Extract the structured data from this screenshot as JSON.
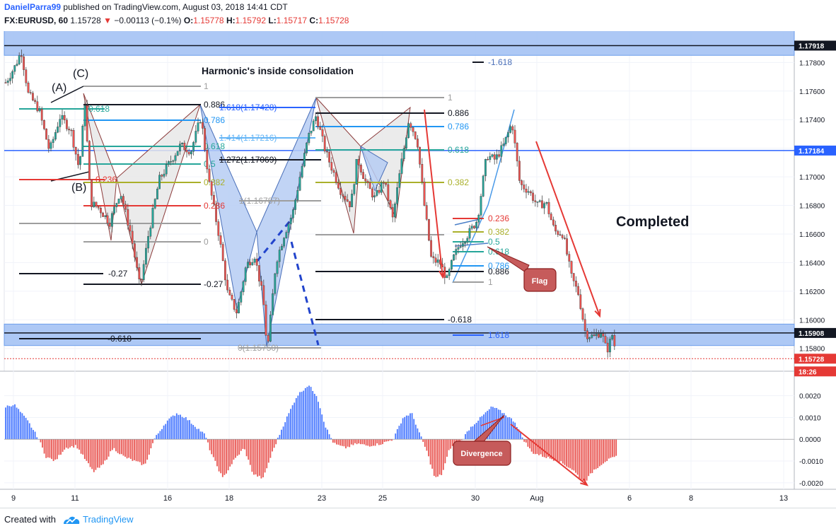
{
  "header": {
    "author": "DanielParra99",
    "published_text": "published on TradingView.com, August 03, 2018 14:41 CDT",
    "symbol": "FX:EURUSD, 60",
    "last": "1.15728",
    "change_arrow": "▼",
    "change": "−0.00113 (−0.1%)",
    "open_label": "O:",
    "open": "1.15778",
    "high_label": "H:",
    "high": "1.15792",
    "low_label": "L:",
    "low": "1.15717",
    "close_label": "C:",
    "close": "1.15728"
  },
  "footer": {
    "created_with": "Created with",
    "brand": "TradingView"
  },
  "colors": {
    "up_candle": "#26a69a",
    "down_candle": "#ef5350",
    "zone": "#a4c2f4",
    "pattern_fill": "#b6cdf3",
    "hist_up": "#2962ff",
    "hist_down": "#e53935",
    "arrow": "#e53935",
    "gold": "#aab02b",
    "accent_blue": "#2962ff"
  },
  "annotations": {
    "title": "Harmonic's inside consolidation",
    "completed": "Completed",
    "flag": "Flag",
    "divergence": "Divergence",
    "label_a": "(A)",
    "label_b": "(B)",
    "label_c": "(C)"
  },
  "chart_data": {
    "type": "candlestick",
    "symbol": "EURUSD",
    "timeframe": "60",
    "ylim": [
      1.1568,
      1.1797
    ],
    "x_ticks": [
      "9",
      "11",
      "16",
      "18",
      "23",
      "25",
      "30",
      "Aug",
      "6",
      "8",
      "13"
    ],
    "price_ticks": [
      "1.17800",
      "1.17600",
      "1.17400",
      "1.17200",
      "1.17000",
      "1.16800",
      "1.16600",
      "1.16400",
      "1.16200",
      "1.16000",
      "1.15800"
    ],
    "price_tags": [
      {
        "label": "1.17918",
        "value": 1.17918,
        "style": "dark"
      },
      {
        "label": "1.17184",
        "value": 1.17184,
        "style": "blue"
      },
      {
        "label": "1.15908",
        "value": 1.15908,
        "style": "dark"
      },
      {
        "label": "1.15728",
        "value": 1.15728,
        "style": "red"
      },
      {
        "label": "18:26",
        "style": "red-countdown"
      }
    ],
    "zones": [
      [
        1.1785,
        1.1805
      ],
      [
        1.1582,
        1.1597
      ]
    ],
    "horizontal_lines": [
      {
        "value": 1.17918,
        "color": "#131722"
      },
      {
        "value": 1.17184,
        "color": "#2962ff"
      },
      {
        "value": 1.15908,
        "color": "#131722"
      }
    ],
    "fib_labels": [
      "1",
      "0.886",
      "0.786",
      "0.618",
      "0.5",
      "0.382",
      "0.236",
      "0",
      "-0.27",
      "-0.618",
      "1.618",
      "1.618(1.17428)",
      "1.414(1.17216)",
      "1.272(1.17069)",
      "1(1.16787)",
      "0(1.15750)",
      "-1.618"
    ],
    "oscillator": {
      "ylim": [
        -0.0022,
        0.0028
      ],
      "ticks": [
        "0.0020",
        "0.0010",
        "0.0000",
        "-0.0010",
        "-0.0020"
      ]
    }
  }
}
